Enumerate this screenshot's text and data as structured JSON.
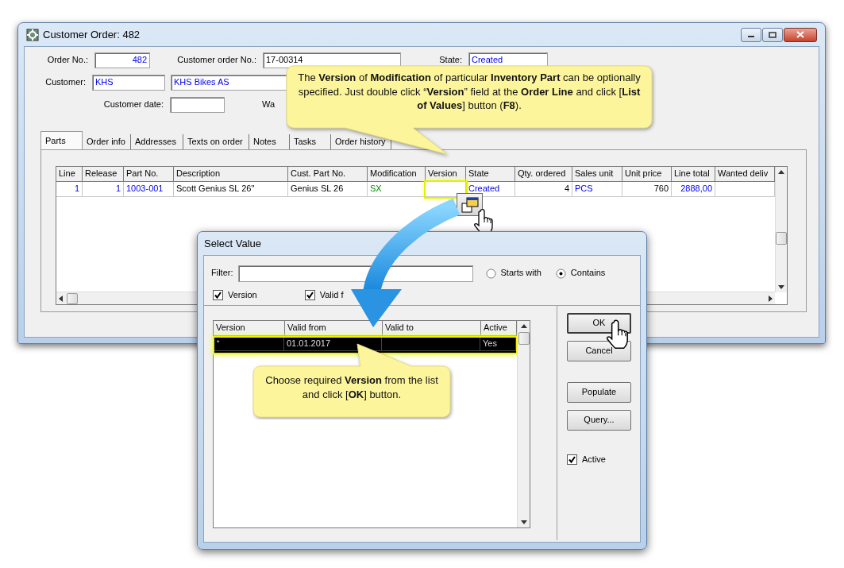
{
  "window": {
    "title": "Customer Order: 482"
  },
  "form_rows": [
    [
      {
        "label": "Order No.:",
        "values": [
          {
            "text": "482",
            "kind": "number"
          }
        ]
      },
      {
        "label": "Customer order No.:",
        "values": [
          {
            "text": "17-00314",
            "kind": "plain"
          }
        ]
      },
      {
        "label": "State:",
        "values": [
          {
            "text": "Created",
            "kind": "link"
          }
        ]
      }
    ],
    [
      {
        "label": "Customer:",
        "values": [
          {
            "text": "KHS",
            "kind": "link"
          },
          {
            "text": "KHS Bikes AS",
            "kind": "link"
          }
        ]
      }
    ],
    [
      {
        "label": "Customer date:",
        "values": [
          {
            "kind": "blank"
          }
        ]
      },
      {
        "label": "Wa"
      }
    ]
  ],
  "tabs": [
    {
      "label": "Parts",
      "selected": true
    },
    {
      "label": "Order info",
      "selected": false
    },
    {
      "label": "Addresses",
      "selected": false
    },
    {
      "label": "Texts on order",
      "selected": false
    },
    {
      "label": "Notes",
      "selected": false
    },
    {
      "label": "Tasks",
      "selected": false
    },
    {
      "label": "Order history",
      "selected": false
    }
  ],
  "table": {
    "columns": [
      "Line",
      "Release",
      "Part No.",
      "Description",
      "Cust. Part No.",
      "Modification",
      "Version",
      "State",
      "Qty. ordered",
      "Sales unit",
      "Unit price",
      "Line total",
      "Wanted deliv"
    ],
    "rows": [
      {
        "cells": [
          {
            "text": "1",
            "kind": "number"
          },
          {
            "text": "1",
            "kind": "number"
          },
          {
            "text": "1003-001",
            "kind": "link"
          },
          {
            "text": "Scott Genius SL 26''",
            "kind": "plain"
          },
          {
            "text": "Genius SL 26",
            "kind": "plain"
          },
          {
            "text": "SX",
            "kind": "code"
          },
          {
            "kind": "editing"
          },
          {
            "text": "Created",
            "kind": "link"
          },
          {
            "text": "4",
            "kind": "amount"
          },
          {
            "text": "PCS",
            "kind": "link"
          },
          {
            "text": "760",
            "kind": "amount"
          },
          {
            "text": "2888,00",
            "kind": "number"
          },
          {
            "kind": "blank"
          }
        ]
      }
    ]
  },
  "dialog": {
    "title": "Select Value",
    "filter_label": "Filter:",
    "match_options": [
      {
        "label": "Starts with",
        "selected": false
      },
      {
        "label": "Contains",
        "selected": true
      }
    ],
    "column_checks": [
      {
        "label": "Version",
        "checked": true
      },
      {
        "label": "Valid f",
        "checked": true
      }
    ],
    "list": {
      "columns": [
        "Version",
        "Valid from",
        "Valid to",
        "Active"
      ],
      "rows": [
        {
          "cells": [
            "*",
            "01.01.2017",
            null,
            "Yes"
          ],
          "selected": true
        }
      ]
    },
    "buttons": [
      {
        "label": "OK",
        "default": true
      },
      {
        "label": "Cancel",
        "default": false
      },
      {
        "label": "Populate",
        "default": false
      },
      {
        "label": "Query...",
        "default": false
      }
    ],
    "active_check": {
      "label": "Active",
      "checked": true
    }
  },
  "callouts": [
    {
      "text": "The **Version** of **Modification** of particular **Inventory Part** can be optionally specified.  Just double click “**Version**” field at the **Order Line** and click [**List of Values**] button (**F8**)."
    },
    {
      "text": "Choose required **Version** from the list and click [**OK**] button."
    }
  ]
}
